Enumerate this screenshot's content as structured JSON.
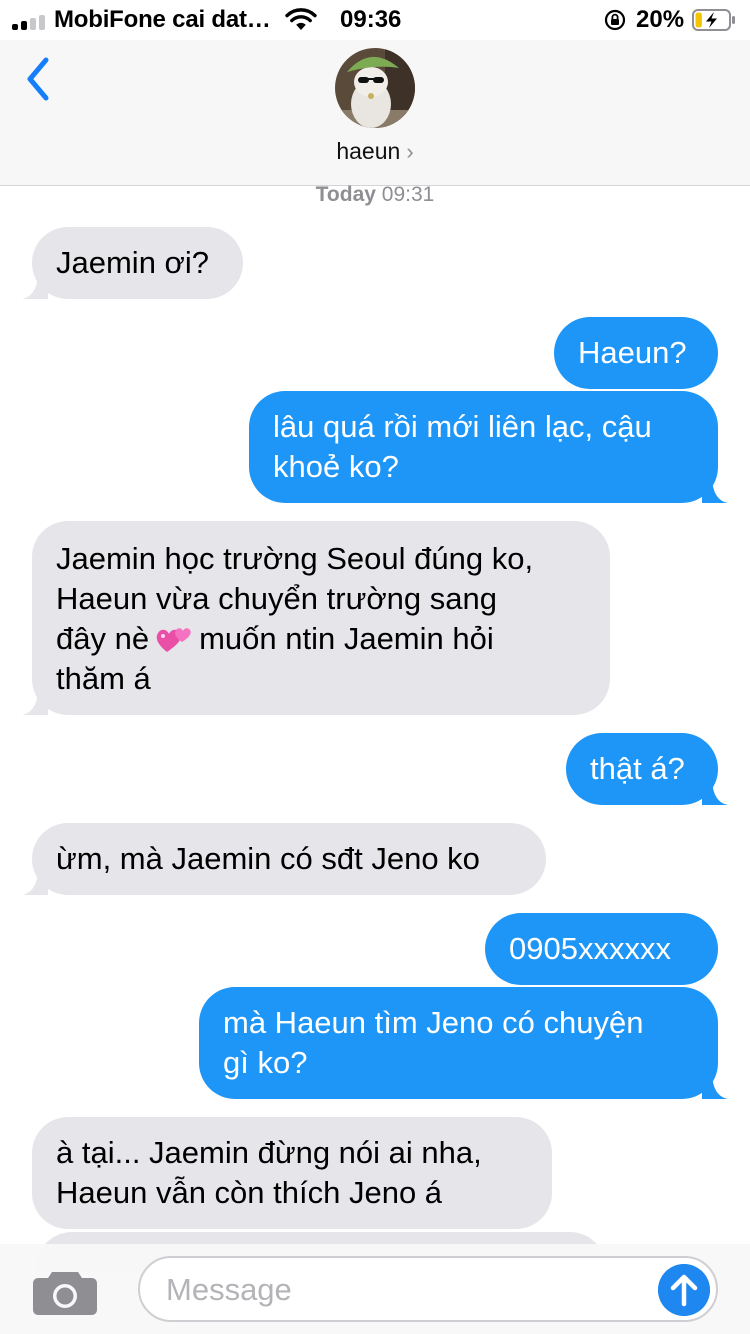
{
  "status_bar": {
    "carrier": "MobiFone cai dat…",
    "time": "09:36",
    "battery_percent": "20%",
    "signal_bars_active": 2,
    "signal_bars_total": 4,
    "battery_level": 0.2,
    "charging": true
  },
  "header": {
    "back_icon": "chevron-left-icon",
    "contact_name": "haeun",
    "contact_chevron": "›"
  },
  "thread": {
    "timestamp_day": "Today",
    "timestamp_time": "09:31",
    "messages": [
      {
        "direction": "incoming",
        "lines": [
          "Jaemin ơi?"
        ]
      },
      {
        "direction": "outgoing",
        "lines": [
          "Haeun?"
        ]
      },
      {
        "direction": "outgoing",
        "lines": [
          "lâu quá rồi mới liên lạc, cậu",
          "khoẻ ko?"
        ]
      },
      {
        "direction": "incoming",
        "lines": [
          "Jaemin học trường Seoul đúng ko,",
          "Haeun vừa chuyển trường sang",
          "đây nè",
          "muốn ntin Jaemin hỏi",
          "thăm á"
        ],
        "emoji": "two-hearts-emoji"
      },
      {
        "direction": "outgoing",
        "lines": [
          "thật á?"
        ]
      },
      {
        "direction": "incoming",
        "lines": [
          "ừm, mà Jaemin có sđt Jeno ko"
        ]
      },
      {
        "direction": "outgoing",
        "lines": [
          "0905xxxxxx"
        ]
      },
      {
        "direction": "outgoing",
        "lines": [
          "mà Haeun tìm Jeno có chuyện",
          "gì ko?"
        ]
      },
      {
        "direction": "incoming",
        "lines": [
          "à tại... Jaemin đừng nói ai nha,",
          "Haeun vẫn còn thích Jeno á"
        ]
      },
      {
        "direction": "incoming",
        "lines": []
      }
    ]
  },
  "input_bar": {
    "placeholder": "Message",
    "value": "",
    "camera_icon": "camera-icon",
    "send_icon": "arrow-up-icon"
  },
  "colors": {
    "incoming_bubble": "#e5e5ea",
    "outgoing_bubble": "#1e96f7",
    "accent": "#1e87f0",
    "header_background": "#f7f7f7"
  }
}
